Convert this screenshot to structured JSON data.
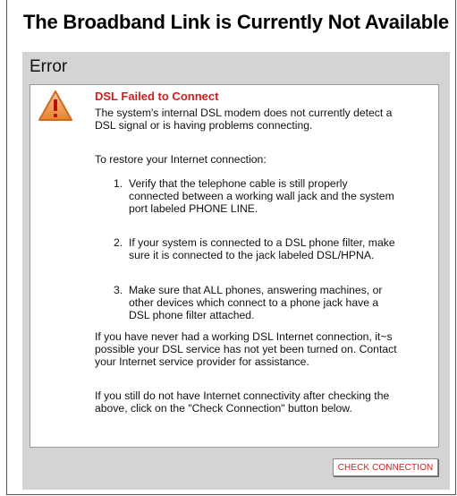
{
  "page": {
    "title": "The Broadband Link is Currently Not Available"
  },
  "panel": {
    "title": "Error"
  },
  "error": {
    "icon": "warning-triangle-icon",
    "title": "DSL Failed to Connect",
    "description_line1": "The system's internal DSL modem does not currently detect a",
    "description_line2": "DSL signal or is having problems connecting.",
    "restore_intro": "To restore your Internet connection:",
    "steps": [
      {
        "number": "1.",
        "lines": [
          "Verify that the telephone cable is still properly",
          "connected between a working wall jack and the system",
          "port labeled PHONE LINE."
        ]
      },
      {
        "number": "2.",
        "lines": [
          "If your system is connected to a DSL phone filter, make",
          "sure it is connected to the jack labeled DSL/HPNA."
        ]
      },
      {
        "number": "3.",
        "lines": [
          "Make sure that ALL phones, answering machines, or",
          "other devices which connect to a phone jack have a",
          "DSL phone filter attached."
        ]
      }
    ],
    "never_had_lines": [
      "If you have never had a working DSL Internet connection, it~s",
      "possible your DSL service has not yet been turned on. Contact",
      "your Internet service provider for assistance."
    ],
    "still_no_lines": [
      "If you still do not have Internet connectivity after checking the",
      "above, click on the \"Check Connection\" button below."
    ]
  },
  "actions": {
    "check_connection_label": "CHECK CONNECTION"
  },
  "colors": {
    "error_red": "#cc1f1f",
    "panel_gray": "#d4d4d4",
    "warning_orange": "#e8832a"
  }
}
